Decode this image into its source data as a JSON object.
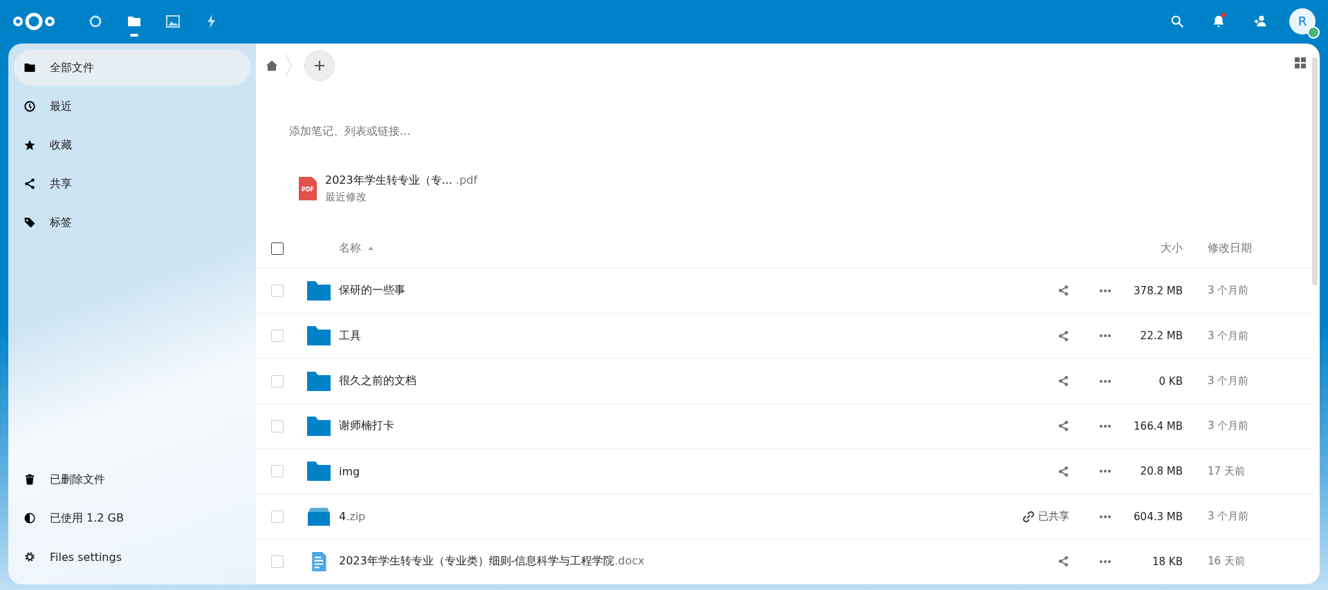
{
  "header": {
    "apps": [
      {
        "kind": "dashboard",
        "selected": false
      },
      {
        "kind": "files",
        "selected": true
      },
      {
        "kind": "photos",
        "selected": false
      },
      {
        "kind": "activity",
        "selected": false
      }
    ],
    "notifications_unread": true,
    "avatar": {
      "initial": "R",
      "online": true
    }
  },
  "sidebar": {
    "items": [
      {
        "kind": "folder",
        "label": "全部文件",
        "selected": true
      },
      {
        "kind": "clock",
        "label": "最近",
        "selected": false
      },
      {
        "kind": "star",
        "label": "收藏",
        "selected": false
      },
      {
        "kind": "share",
        "label": "共享",
        "selected": false
      },
      {
        "kind": "tag",
        "label": "标签",
        "selected": false
      }
    ],
    "footer": [
      {
        "kind": "trash",
        "label": "已删除文件"
      },
      {
        "kind": "quota",
        "label": "已使用 1.2 GB"
      },
      {
        "kind": "gear",
        "label": "Files settings"
      }
    ]
  },
  "note": {
    "placeholder": "添加笔记、列表或链接..."
  },
  "recent": {
    "name": "2023年学生转专业（专...",
    "ext": ".pdf",
    "subtitle": "最近修改",
    "badge": "PDF"
  },
  "table": {
    "select_all": {
      "checked": false
    },
    "columns": [
      {
        "label": "名称",
        "sorted": true
      },
      {
        "label": "大小"
      },
      {
        "label": "修改日期"
      }
    ],
    "rows": [
      {
        "kind": "folder",
        "name": "保研的一些事",
        "ext": "",
        "shared": false,
        "size": "378.2 MB",
        "modified": "3 个月前",
        "checked": false
      },
      {
        "kind": "folder",
        "name": "工具",
        "ext": "",
        "shared": false,
        "size": "22.2 MB",
        "modified": "3 个月前",
        "checked": false
      },
      {
        "kind": "folder",
        "name": "很久之前的文档",
        "ext": "",
        "shared": false,
        "size": "0 KB",
        "modified": "3 个月前",
        "checked": false
      },
      {
        "kind": "folder",
        "name": "谢师楠打卡",
        "ext": "",
        "shared": false,
        "size": "166.4 MB",
        "modified": "3 个月前",
        "checked": false
      },
      {
        "kind": "folder",
        "name": "img",
        "ext": "",
        "shared": false,
        "size": "20.8 MB",
        "modified": "17 天前",
        "checked": false
      },
      {
        "kind": "zip",
        "name": "4",
        "ext": ".zip",
        "shared": true,
        "share_label": "已共享",
        "size": "604.3 MB",
        "modified": "3 个月前",
        "checked": false
      },
      {
        "kind": "doc",
        "name": "2023年学生转专业（专业类）细则-信息科学与工程学院",
        "ext": ".docx",
        "shared": false,
        "size": "18 KB",
        "modified": "16 天前",
        "checked": false
      }
    ]
  }
}
